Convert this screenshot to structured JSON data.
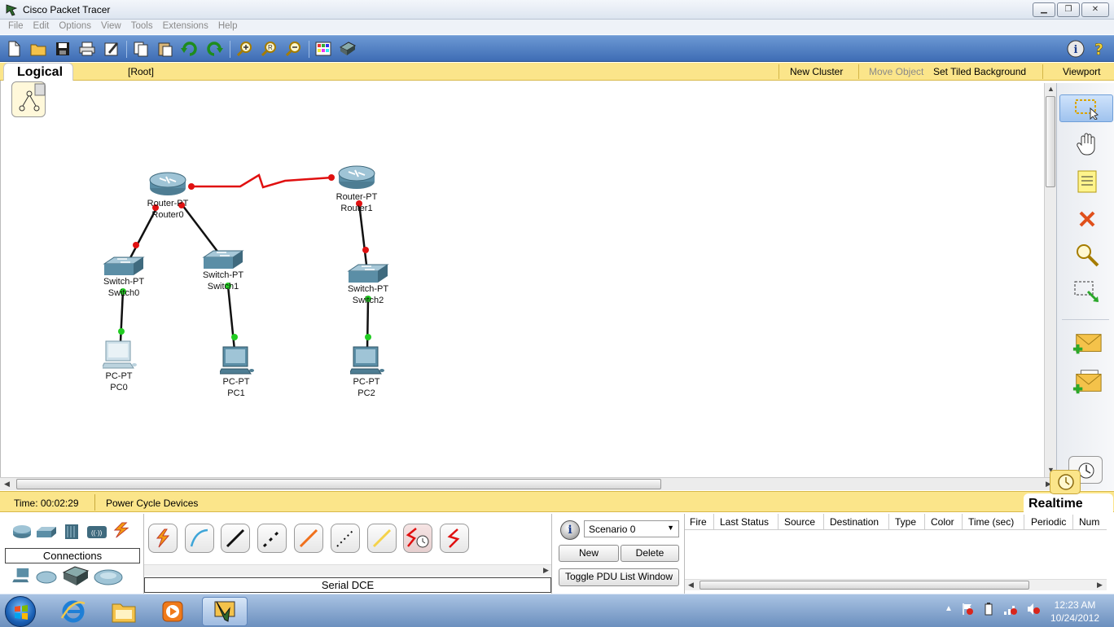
{
  "window": {
    "title": "Cisco Packet Tracer",
    "buttons": [
      "minimize",
      "restore",
      "close"
    ]
  },
  "menu": {
    "items": [
      "File",
      "Edit",
      "Options",
      "View",
      "Tools",
      "Extensions",
      "Help"
    ]
  },
  "toolbar": {
    "buttons": [
      "new-icon",
      "open-icon",
      "save-icon",
      "print-icon",
      "activity-wizard-icon",
      "copy-icon",
      "paste-icon",
      "undo-icon",
      "redo-icon",
      "zoom-in-icon",
      "zoom-reset-icon",
      "zoom-out-icon",
      "palette-icon",
      "custom-device-icon"
    ],
    "right_buttons": [
      "info-icon",
      "help-icon"
    ]
  },
  "workspace_bar": {
    "tab": "Logical",
    "root": "[Root]",
    "new_cluster": "New Cluster",
    "move_object": "Move Object",
    "set_tiled_background": "Set Tiled Background",
    "viewport": "Viewport"
  },
  "topology": {
    "devices": [
      {
        "type": "Router-PT",
        "name": "Router0"
      },
      {
        "type": "Router-PT",
        "name": "Router1"
      },
      {
        "type": "Switch-PT",
        "name": "Switch0"
      },
      {
        "type": "Switch-PT",
        "name": "Switch1"
      },
      {
        "type": "Switch-PT",
        "name": "Switch2"
      },
      {
        "type": "PC-PT",
        "name": "PC0"
      },
      {
        "type": "PC-PT",
        "name": "PC1"
      },
      {
        "type": "PC-PT",
        "name": "PC2"
      }
    ],
    "links": [
      {
        "from": "Router0",
        "to": "Router1",
        "kind": "serial",
        "status": "down"
      },
      {
        "from": "Router0",
        "to": "Switch0",
        "kind": "straight",
        "status": "down"
      },
      {
        "from": "Router0",
        "to": "Switch1",
        "kind": "straight",
        "status": "down"
      },
      {
        "from": "Router1",
        "to": "Switch2",
        "kind": "straight",
        "status": "down"
      },
      {
        "from": "Switch0",
        "to": "PC0",
        "kind": "straight",
        "status": "up"
      },
      {
        "from": "Switch1",
        "to": "PC1",
        "kind": "straight",
        "status": "up"
      },
      {
        "from": "Switch2",
        "to": "PC2",
        "kind": "straight",
        "status": "up"
      }
    ]
  },
  "palette": {
    "tools": [
      "select-icon",
      "move-layout-icon",
      "place-note-icon",
      "delete-icon",
      "inspect-icon",
      "resize-shape-icon",
      "add-simple-pdu-icon",
      "add-complex-pdu-icon"
    ]
  },
  "status_bar": {
    "time": "Time: 00:02:29",
    "power_cycle": "Power Cycle Devices",
    "mode": "Realtime"
  },
  "device_panel": {
    "category_label": "Connections",
    "selected_connection": "Serial DCE",
    "connection_types": [
      "automatic",
      "console",
      "copper-straight",
      "copper-cross",
      "crossover",
      "fiber",
      "phone",
      "coaxial",
      "serial-dce",
      "serial-dte"
    ]
  },
  "scenario": {
    "selected": "Scenario 0",
    "new_label": "New",
    "delete_label": "Delete",
    "toggle_label": "Toggle PDU List Window"
  },
  "pdu_table": {
    "columns": [
      "Fire",
      "Last Status",
      "Source",
      "Destination",
      "Type",
      "Color",
      "Time (sec)",
      "Periodic",
      "Num"
    ]
  },
  "taskbar": {
    "time": "12:23 AM",
    "date": "10/24/2012"
  },
  "colors": {
    "link_up": "#22cc22",
    "link_down": "#e01010",
    "serial_cable": "#e01010",
    "workspace_bar": "#fbe58a",
    "toolbar": "#4a7cc2"
  }
}
